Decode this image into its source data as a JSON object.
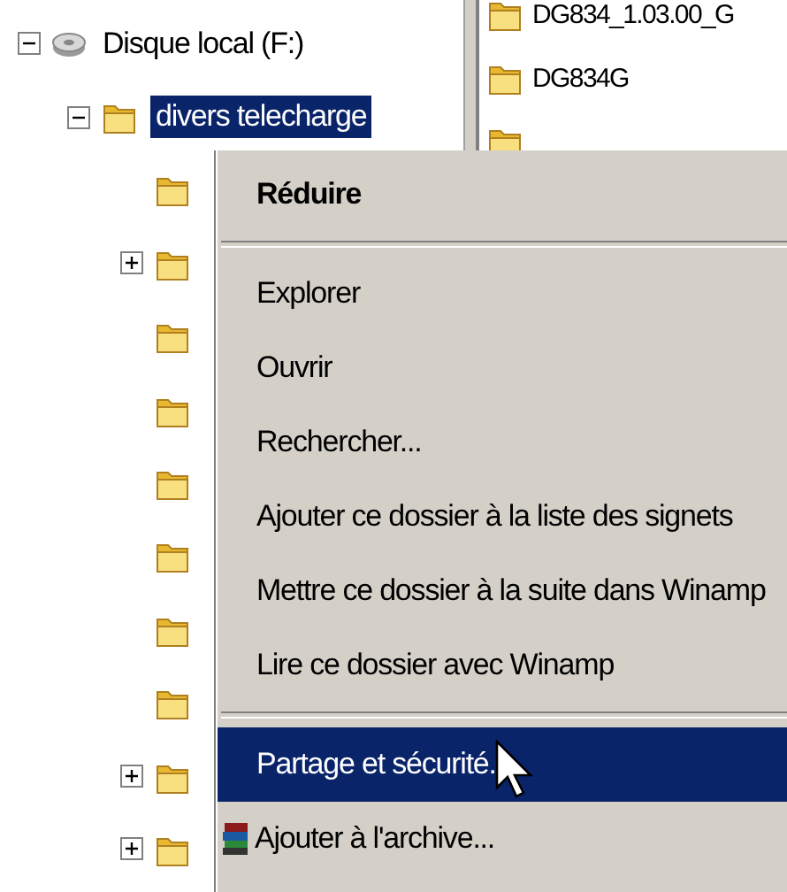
{
  "tree": {
    "label": "Disque local (F:)",
    "expanded": true,
    "children": [
      {
        "label": "divers telecharge",
        "selected": true,
        "expanded": true,
        "children": [
          {
            "expandable": false
          },
          {
            "expandable": true
          },
          {
            "expandable": false
          },
          {
            "expandable": false
          },
          {
            "expandable": false
          },
          {
            "expandable": false
          },
          {
            "expandable": false
          },
          {
            "expandable": false
          },
          {
            "expandable": true
          },
          {
            "expandable": true
          }
        ]
      }
    ]
  },
  "files": [
    {
      "kind": "folder",
      "label": "DG834_1.03.00_G"
    },
    {
      "kind": "folder",
      "label": "DG834G"
    },
    {
      "kind": "folder"
    }
  ],
  "context_menu": [
    {
      "kind": "item",
      "label": "Réduire",
      "default": true,
      "selected": false
    },
    {
      "kind": "separator"
    },
    {
      "kind": "item",
      "label": "Explorer",
      "selected": false
    },
    {
      "kind": "item",
      "label": "Ouvrir",
      "selected": false
    },
    {
      "kind": "item",
      "label": "Rechercher...",
      "selected": false
    },
    {
      "kind": "item",
      "label": "Ajouter ce dossier à la liste des signets",
      "selected": false
    },
    {
      "kind": "item",
      "label": "Mettre ce dossier à la suite dans Winamp",
      "selected": false
    },
    {
      "kind": "item",
      "label": "Lire ce dossier avec Winamp",
      "selected": false
    },
    {
      "kind": "separator"
    },
    {
      "kind": "item",
      "label": "Partage et sécurité.",
      "selected": true
    },
    {
      "kind": "archive",
      "label": "Ajouter à l'archive...",
      "selected": false
    }
  ]
}
